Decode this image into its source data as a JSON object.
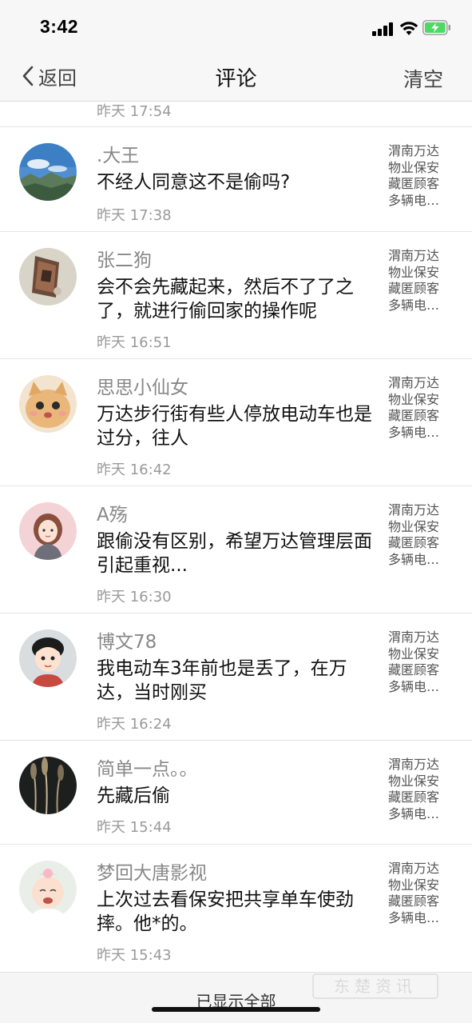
{
  "status_bar": {
    "time": "3:42"
  },
  "nav": {
    "back_label": "返回",
    "title": "评论",
    "clear_label": "清空"
  },
  "partial_item": {
    "date": "昨天 17:54"
  },
  "comments": [
    {
      "name": ".大王",
      "text": "不经人同意这不是偷吗?",
      "date": "昨天 17:38",
      "source": "渭南万达物业保安藏匿顾客多辆电…"
    },
    {
      "name": "张二狗",
      "text": "会不会先藏起来，然后不了了之了，就进行偷回家的操作呢",
      "date": "昨天 16:51",
      "source": "渭南万达物业保安藏匿顾客多辆电…"
    },
    {
      "name": "思思小仙女",
      "text": "万达步行街有些人停放电动车也是过分，往人",
      "date": "昨天 16:42",
      "source": "渭南万达物业保安藏匿顾客多辆电…"
    },
    {
      "name": "A殇",
      "text": "跟偷没有区别，希望万达管理层面引起重视...",
      "date": "昨天 16:30",
      "source": "渭南万达物业保安藏匿顾客多辆电…"
    },
    {
      "name": "博文78",
      "text": "我电动车3年前也是丢了，在万达，当时刚买",
      "date": "昨天 16:24",
      "source": "渭南万达物业保安藏匿顾客多辆电…"
    },
    {
      "name": "简单一点。。",
      "text": "先藏后偷",
      "date": "昨天 15:44",
      "source": "渭南万达物业保安藏匿顾客多辆电…"
    },
    {
      "name": "梦回大唐影视",
      "text": "上次过去看保安把共享单车使劲摔。他*的。",
      "date": "昨天 15:43",
      "source": "渭南万达物业保安藏匿顾客多辆电…"
    }
  ],
  "footer": {
    "label": "已显示全部"
  },
  "watermark": {
    "text": "东楚资讯"
  },
  "colors": {
    "nav_bg": "#f7f7f7",
    "name": "#888888",
    "date": "#9a9a9a",
    "battery": "#4cd964"
  }
}
